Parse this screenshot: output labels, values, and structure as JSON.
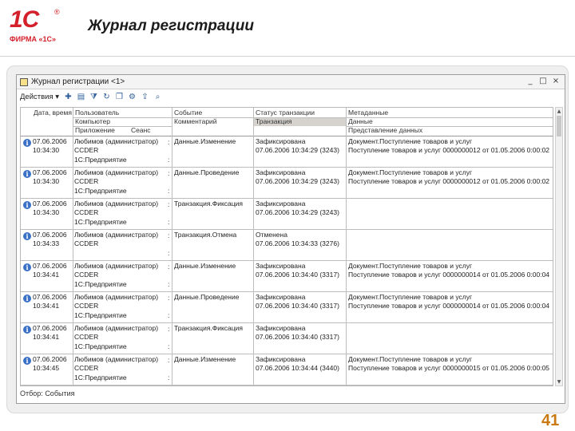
{
  "slide": {
    "logo_text": "1С",
    "logo_sub": "ФИРМА «1С»",
    "title": "Журнал регистрации",
    "page_number": "41"
  },
  "window": {
    "title": "Журнал регистрации <1>",
    "controls": [
      "_",
      "□",
      "×"
    ]
  },
  "toolbar": {
    "actions_label": "Действия ▾",
    "icons": [
      "add-icon",
      "open-icon",
      "filter-icon",
      "refresh-icon",
      "copy-icon",
      "settings-icon",
      "export-icon",
      "find-icon"
    ]
  },
  "grid": {
    "header": {
      "date": "Дата, время",
      "user": "Пользователь",
      "computer": "Компьютер",
      "application": "Приложение",
      "session": "Сеанс",
      "event": "Событие",
      "comment": "Комментарий",
      "tx_status": "Статус транзакции",
      "transaction": "Транзакция",
      "metadata": "Метаданные",
      "data": "Данные",
      "data_repr": "Представление данных"
    },
    "rows": [
      {
        "date": "07.06.2006",
        "time": "10:34:30",
        "user": "Любимов (администратор)",
        "computer": "CCDER",
        "app": "1С:Предприятие",
        "event": "Данные.Изменение",
        "status": "Зафиксирована",
        "tx": "07.06.2006 10:34:29 (3243)",
        "meta": "Документ.Поступление товаров и услуг",
        "data_repr": "Поступление товаров и услуг 0000000012 от 01.05.2006 0:00:02"
      },
      {
        "date": "07.06.2006",
        "time": "10:34:30",
        "user": "Любимов (администратор)",
        "computer": "CCDER",
        "app": "1С:Предприятие",
        "event": "Данные.Проведение",
        "status": "Зафиксирована",
        "tx": "07.06.2006 10:34:29 (3243)",
        "meta": "Документ.Поступление товаров и услуг",
        "data_repr": "Поступление товаров и услуг 0000000012 от 01.05.2006 0:00:02"
      },
      {
        "date": "07.06.2006",
        "time": "10:34:30",
        "user": "Любимов (администратор)",
        "computer": "CCDER",
        "app": "1С:Предприятие",
        "event": "Транзакция.Фиксация",
        "status": "Зафиксирована",
        "tx": "07.06.2006 10:34:29 (3243)",
        "meta": "",
        "data_repr": ""
      },
      {
        "date": "07.06.2006",
        "time": "10:34:33",
        "user": "Любимов (администратор)",
        "computer": "CCDER",
        "app": "",
        "event": "Транзакция.Отмена",
        "status": "Отменена",
        "tx": "07.06.2006 10:34:33 (3276)",
        "meta": "",
        "data_repr": ""
      },
      {
        "date": "07.06.2006",
        "time": "10:34:41",
        "user": "Любимов (администратор)",
        "computer": "CCDER",
        "app": "1С:Предприятие",
        "event": "Данные.Изменение",
        "status": "Зафиксирована",
        "tx": "07.06.2006 10:34:40 (3317)",
        "meta": "Документ.Поступление товаров и услуг",
        "data_repr": "Поступление товаров и услуг 0000000014 от 01.05.2006 0:00:04"
      },
      {
        "date": "07.06.2006",
        "time": "10:34:41",
        "user": "Любимов (администратор)",
        "computer": "CCDER",
        "app": "1С:Предприятие",
        "event": "Данные.Проведение",
        "status": "Зафиксирована",
        "tx": "07.06.2006 10:34:40 (3317)",
        "meta": "Документ.Поступление товаров и услуг",
        "data_repr": "Поступление товаров и услуг 0000000014 от 01.05.2006 0:00:04"
      },
      {
        "date": "07.06.2006",
        "time": "10:34:41",
        "user": "Любимов (администратор)",
        "computer": "CCDER",
        "app": "1С:Предприятие",
        "event": "Транзакция.Фиксация",
        "status": "Зафиксирована",
        "tx": "07.06.2006 10:34:40 (3317)",
        "meta": "",
        "data_repr": ""
      },
      {
        "date": "07.06.2006",
        "time": "10:34:45",
        "user": "Любимов (администратор)",
        "computer": "CCDER",
        "app": "1С:Предприятие",
        "event": "Данные.Изменение",
        "status": "Зафиксирована",
        "tx": "07.06.2006 10:34:44 (3440)",
        "meta": "Документ.Поступление товаров и услуг",
        "data_repr": "Поступление товаров и услуг 0000000015 от 01.05.2006 0:00:05"
      }
    ]
  },
  "status": {
    "filter_label": "Отбор:",
    "filter_value": "События"
  }
}
